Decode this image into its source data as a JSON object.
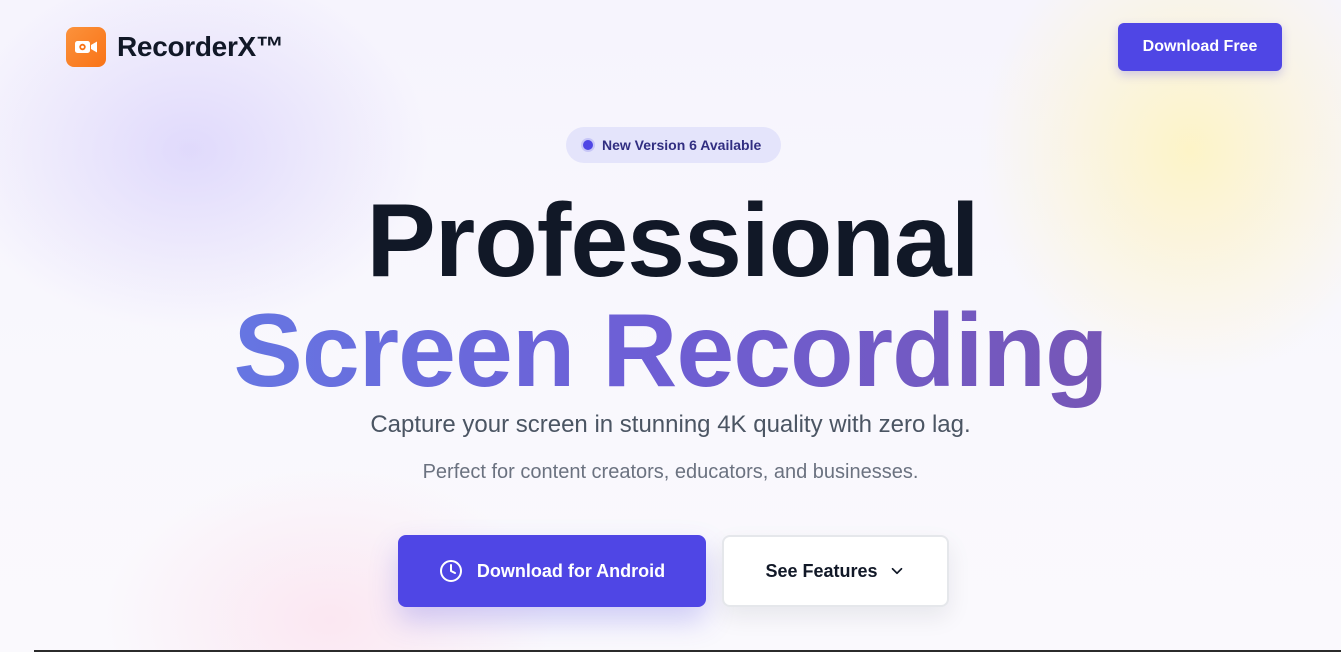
{
  "brand": {
    "name": "RecorderX™",
    "logo_icon": "video-camera-icon",
    "logo_color": "#f97316"
  },
  "header": {
    "cta_label": "Download Free"
  },
  "badge": {
    "text": "New Version 6 Available"
  },
  "hero": {
    "title_line1": "Professional",
    "title_line2": "Screen Recording",
    "subtitle": "Capture your screen in stunning 4K quality with zero lag.",
    "subtitle2": "Perfect for content creators, educators, and businesses."
  },
  "actions": {
    "primary_label": "Download for Android",
    "primary_icon": "clock-icon",
    "secondary_label": "See Features",
    "secondary_icon": "chevron-down-icon"
  },
  "colors": {
    "accent": "#4f46e5",
    "gradient_start": "#6676e2",
    "gradient_end": "#7656b6",
    "heading": "#111827"
  }
}
